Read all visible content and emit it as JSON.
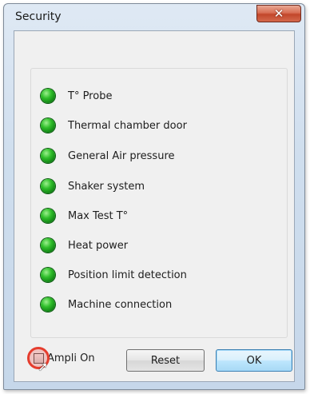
{
  "window": {
    "title": "Security",
    "close_glyph": "✕"
  },
  "indicators": [
    {
      "label": "T° Probe",
      "status": "ok",
      "color": "#2fbe2a"
    },
    {
      "label": "Thermal chamber door",
      "status": "ok",
      "color": "#2fbe2a"
    },
    {
      "label": "General Air pressure",
      "status": "ok",
      "color": "#2fbe2a"
    },
    {
      "label": "Shaker system",
      "status": "ok",
      "color": "#2fbe2a"
    },
    {
      "label": "Max Test T°",
      "status": "ok",
      "color": "#2fbe2a"
    },
    {
      "label": "Heat power",
      "status": "ok",
      "color": "#2fbe2a"
    },
    {
      "label": "Position limit detection",
      "status": "ok",
      "color": "#2fbe2a"
    },
    {
      "label": "Machine connection",
      "status": "ok",
      "color": "#2fbe2a"
    }
  ],
  "footer": {
    "checkbox_label": "Ampli On",
    "checked": false,
    "reset_label": "Reset",
    "ok_label": "OK"
  },
  "colors": {
    "led_green": "#2fbe2a",
    "close_red": "#c2462a",
    "default_button_border": "#3c7fb1"
  },
  "icons": {
    "close": "close-icon",
    "status": "status-led-icon",
    "cursor": "mouse-cursor-icon"
  }
}
